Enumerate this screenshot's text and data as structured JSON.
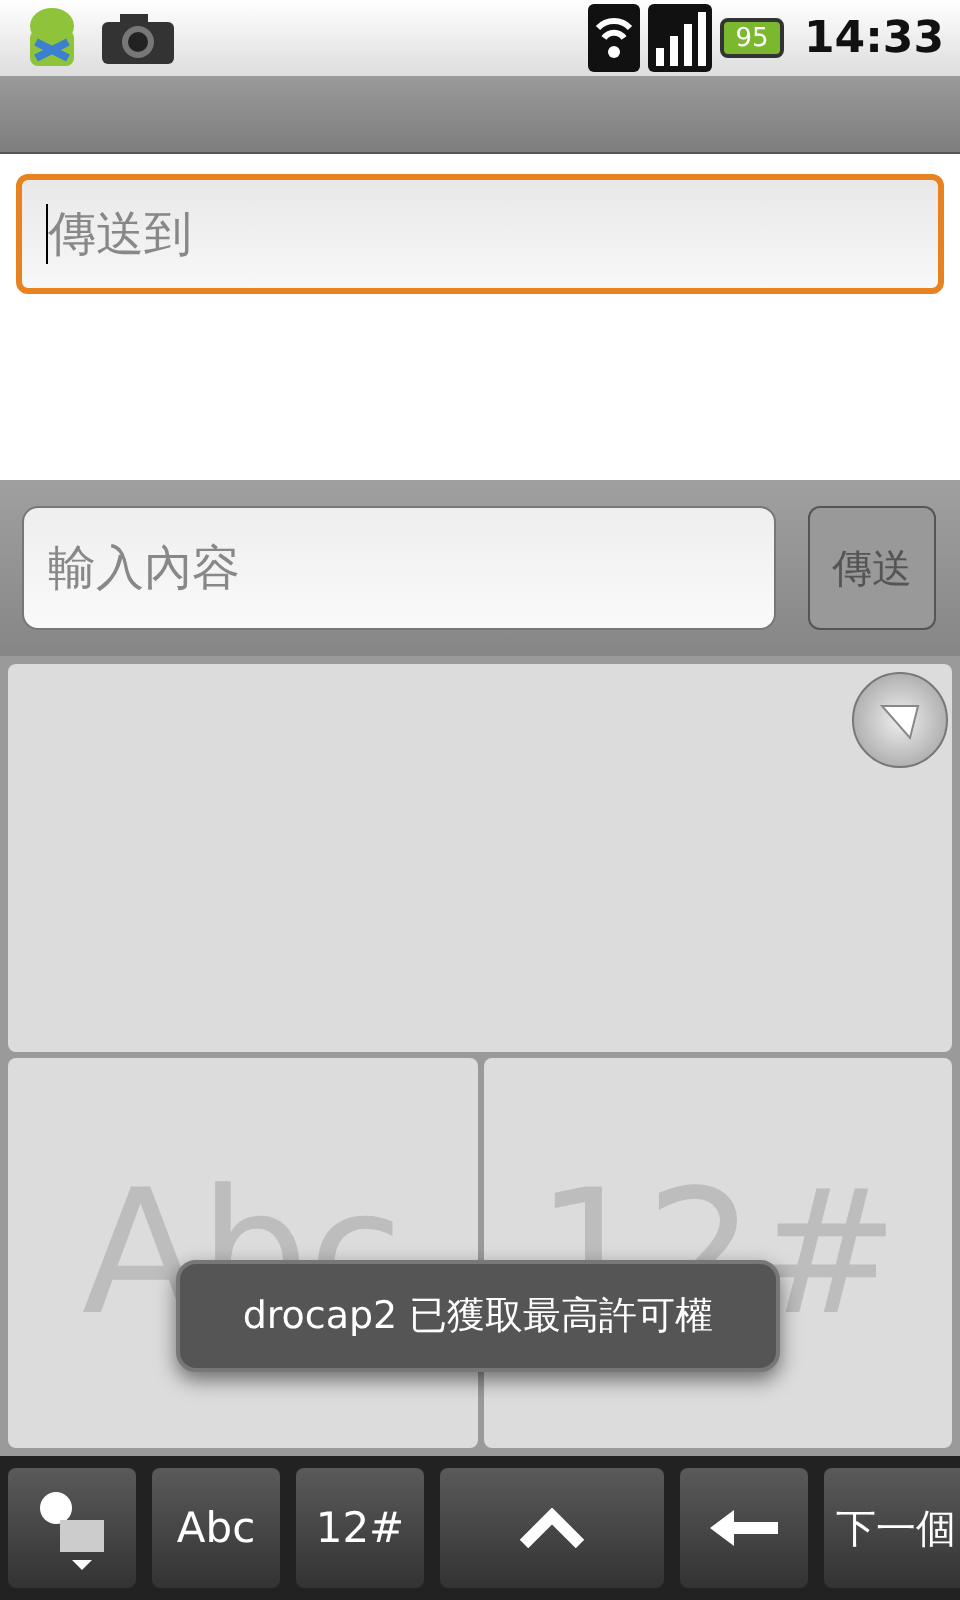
{
  "status_bar": {
    "battery": "95",
    "time": "14:33"
  },
  "recipient_field": {
    "placeholder": "傳送到",
    "focused": true
  },
  "message_field": {
    "placeholder": "輸入內容"
  },
  "send_button": {
    "label": "傳送"
  },
  "handwriting_pad": {
    "labels": [
      "Abc",
      "12#"
    ]
  },
  "toast": {
    "text": "drocap2 已獲取最高許可權"
  },
  "keyboard_keys": [
    {
      "kind": "settings"
    },
    {
      "kind": "text",
      "label": "Abc"
    },
    {
      "kind": "text",
      "label": "12#"
    },
    {
      "kind": "up"
    },
    {
      "kind": "backspace"
    },
    {
      "kind": "text",
      "label": "下一個"
    }
  ]
}
